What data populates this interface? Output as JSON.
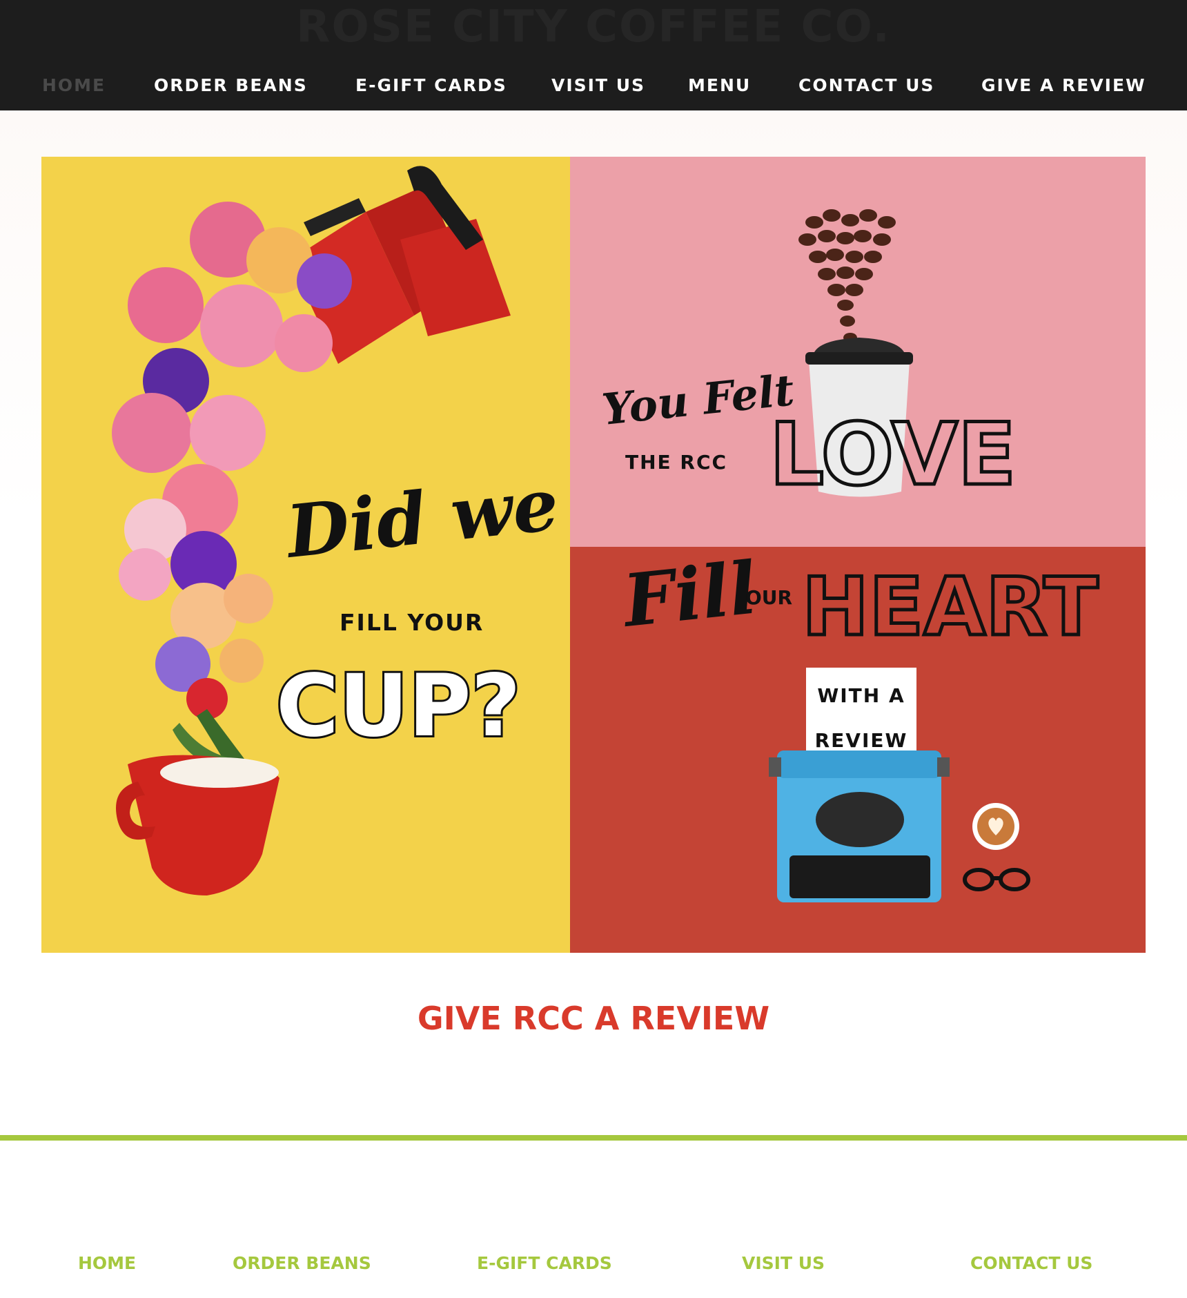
{
  "header": {
    "site_title": "ROSE CITY COFFEE CO.",
    "nav": [
      {
        "label": "HOME",
        "active": true
      },
      {
        "label": "ORDER BEANS"
      },
      {
        "label": "E-GIFT CARDS"
      },
      {
        "label": "VISIT US"
      },
      {
        "label": "MENU"
      },
      {
        "label": "CONTACT US"
      },
      {
        "label": "GIVE A REVIEW"
      }
    ]
  },
  "hero": {
    "left_panel": {
      "script_line": "Did we",
      "caps_line": "FILL YOUR",
      "big_line": "CUP?"
    },
    "top_right_panel": {
      "script_line": "You Felt",
      "caps_line": "THE RCC",
      "big_word": "LOVE"
    },
    "bottom_right_panel": {
      "script_word": "Fill",
      "small_word": "OUR",
      "big_word": "HEART",
      "paper_line_1": "WITH A",
      "paper_line_2": "REVIEW"
    }
  },
  "review_section": {
    "title": "GIVE RCC A REVIEW"
  },
  "footer": {
    "nav": [
      {
        "label": "HOME"
      },
      {
        "label": "ORDER BEANS"
      },
      {
        "label": "E-GIFT CARDS"
      },
      {
        "label": "VISIT US"
      },
      {
        "label": "CONTACT US"
      }
    ]
  },
  "colors": {
    "header_bg": "#1d1d1d",
    "accent_red": "#d93a2b",
    "accent_green": "#a5c83e",
    "hero_yellow": "#f3d24a",
    "hero_pink": "#eca0a8",
    "hero_red": "#c44435"
  }
}
